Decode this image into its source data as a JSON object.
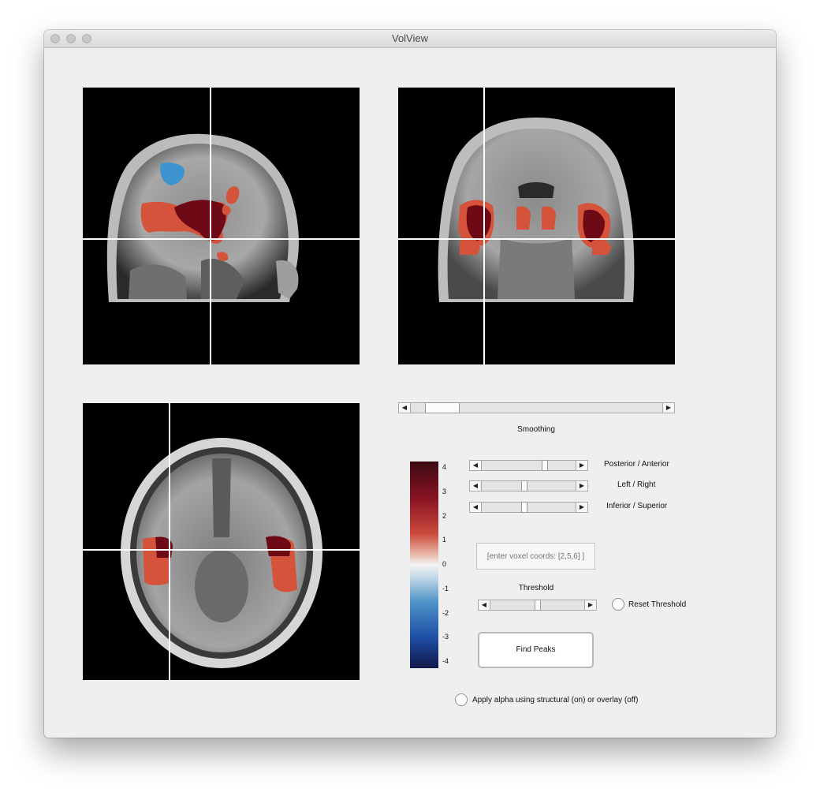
{
  "window": {
    "title": "VolView"
  },
  "colorbar": {
    "ticks": [
      "4",
      "3",
      "2",
      "1",
      "0",
      "-1",
      "-2",
      "-3",
      "-4"
    ]
  },
  "controls": {
    "smoothing_label": "Smoothing",
    "smoothing_value": 0.07,
    "posterior_anterior_label": "Posterior / Anterior",
    "posterior_anterior_value": 0.68,
    "left_right_label": "Left / Right",
    "left_right_value": 0.45,
    "inferior_superior_label": "Inferior / Superior",
    "inferior_superior_value": 0.45,
    "coords_placeholder": "[enter voxel coords: [2,5,6] ]",
    "threshold_label": "Threshold",
    "threshold_value": 0.5,
    "reset_threshold_label": "Reset Threshold",
    "find_peaks_label": "Find Peaks",
    "apply_alpha_label": "Apply alpha using structural (on) or overlay (off)"
  },
  "colors": {
    "overlay_dark_red": "#6e0a16",
    "overlay_orange": "#d4533a",
    "overlay_blue": "#3d94cf",
    "crosshair": "#ffffff"
  }
}
